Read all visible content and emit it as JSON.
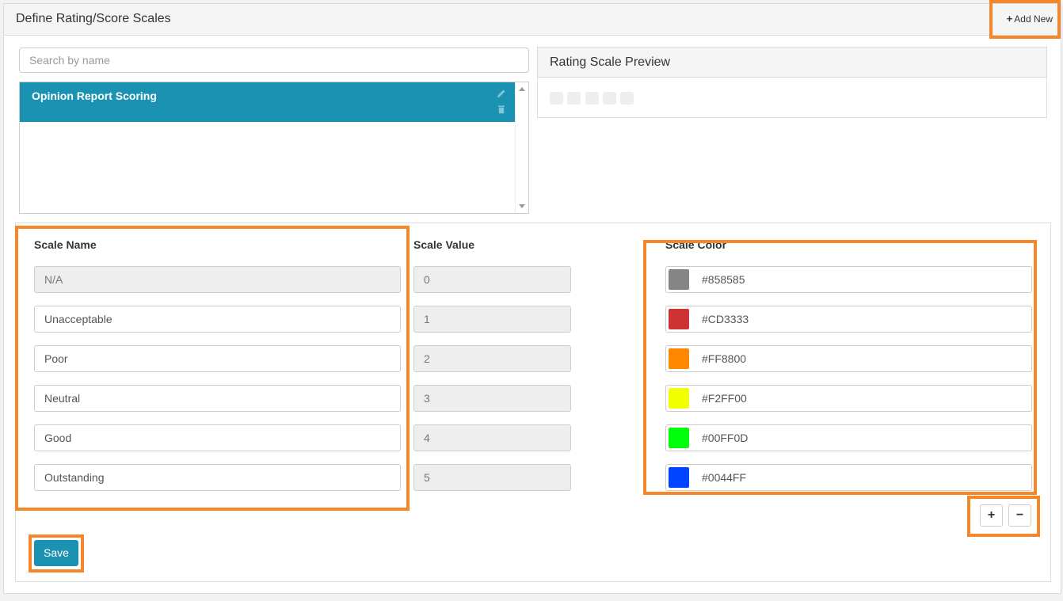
{
  "header": {
    "title": "Define Rating/Score Scales",
    "add_new_label": "Add New",
    "add_new_icon": "plus-icon"
  },
  "search": {
    "placeholder": "Search by name",
    "value": ""
  },
  "scale_list": {
    "items": [
      {
        "label": "Opinion Report Scoring",
        "selected": true
      }
    ],
    "edit_icon": "pencil-icon",
    "delete_icon": "trash-icon"
  },
  "preview": {
    "title": "Rating Scale Preview",
    "box_count": 5
  },
  "columns": {
    "name": "Scale Name",
    "value": "Scale Value",
    "color": "Scale Color"
  },
  "rows": [
    {
      "name": "N/A",
      "value": "0",
      "color": "#858585",
      "name_readonly": true
    },
    {
      "name": "Unacceptable",
      "value": "1",
      "color": "#CD3333",
      "name_readonly": false
    },
    {
      "name": "Poor",
      "value": "2",
      "color": "#FF8800",
      "name_readonly": false
    },
    {
      "name": "Neutral",
      "value": "3",
      "color": "#F2FF00",
      "name_readonly": false
    },
    {
      "name": "Good",
      "value": "4",
      "color": "#00FF0D",
      "name_readonly": false
    },
    {
      "name": "Outstanding",
      "value": "5",
      "color": "#0044FF",
      "name_readonly": false
    }
  ],
  "controls": {
    "add_row_label": "+",
    "remove_row_label": "−",
    "save_label": "Save"
  },
  "theme": {
    "accent": "#1b92b1",
    "highlight": "#f5872a"
  }
}
